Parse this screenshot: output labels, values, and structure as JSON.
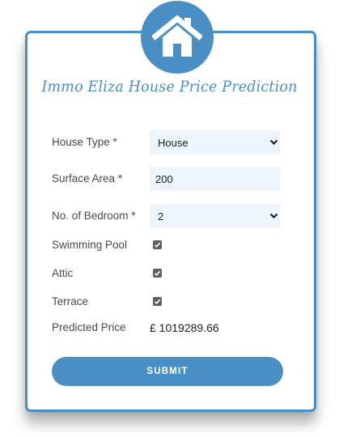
{
  "header": {
    "logo_icon": "house-icon",
    "title": "Immo Eliza House Price Prediction",
    "accent_color": "#4a8ec6"
  },
  "form": {
    "house_type": {
      "label": "House Type *",
      "selected": "House"
    },
    "surface_area": {
      "label": "Surface Area *",
      "value": "200"
    },
    "bedrooms": {
      "label": "No. of Bedroom *",
      "selected": "2"
    },
    "swimming_pool": {
      "label": "Swimming Pool",
      "checked": true
    },
    "attic": {
      "label": "Attic",
      "checked": true
    },
    "terrace": {
      "label": "Terrace",
      "checked": true
    },
    "predicted_price": {
      "label": "Predicted Price",
      "value": "£ 1019289.66"
    }
  },
  "submit": {
    "label": "SUBMIT"
  }
}
